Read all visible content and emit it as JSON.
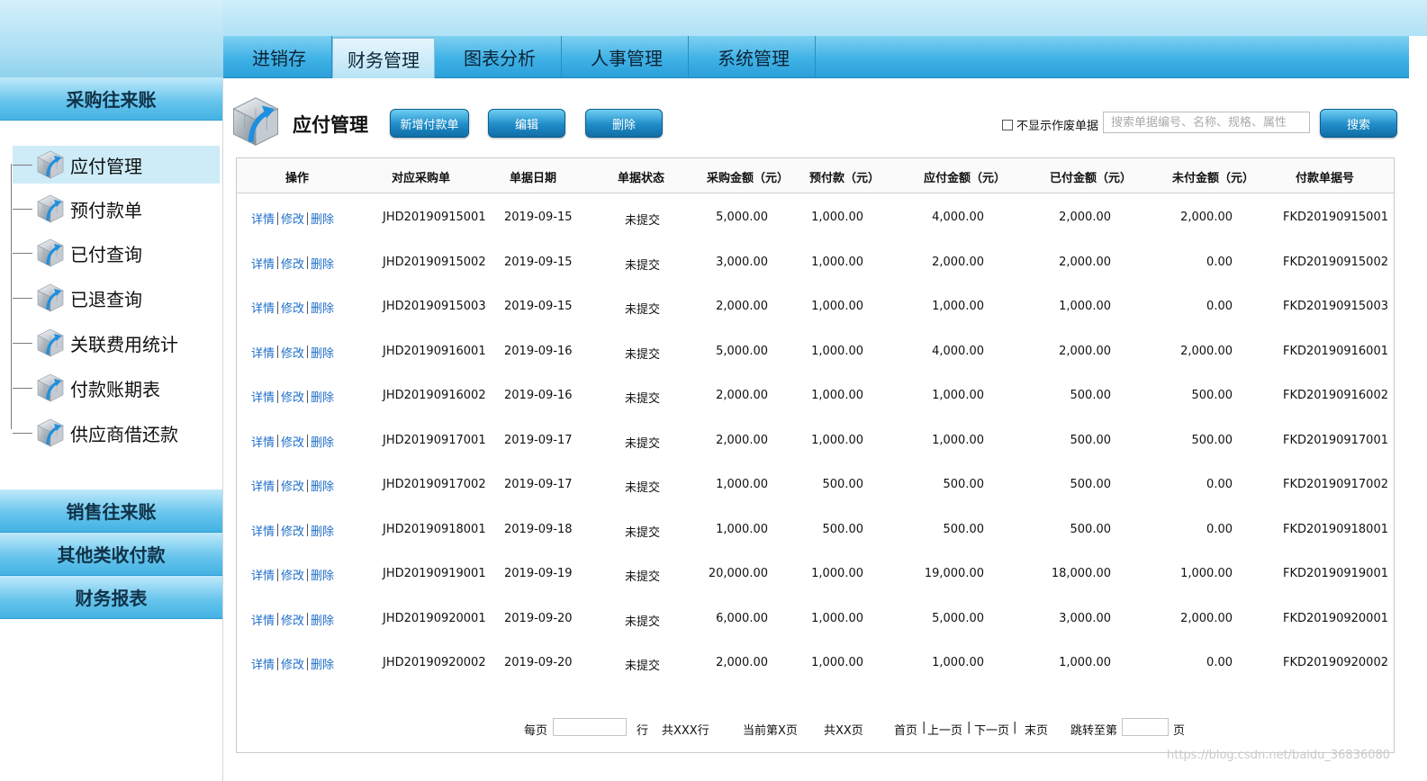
{
  "nav": {
    "tabs": [
      {
        "label": "进销存"
      },
      {
        "label": "财务管理"
      },
      {
        "label": "图表分析"
      },
      {
        "label": "人事管理"
      },
      {
        "label": "系统管理"
      }
    ],
    "active_index": 1
  },
  "sidebar": {
    "section_purchase": "采购往来账",
    "items": [
      {
        "label": "应付管理"
      },
      {
        "label": "预付款单"
      },
      {
        "label": "已付查询"
      },
      {
        "label": "已退查询"
      },
      {
        "label": "关联费用统计"
      },
      {
        "label": "付款账期表"
      },
      {
        "label": "供应商借还款"
      }
    ],
    "section_sales": "销售往来账",
    "section_other": "其他类收付款",
    "section_reports": "财务报表"
  },
  "page": {
    "title": "应付管理",
    "btn_new": "新增付款单",
    "btn_edit": "编辑",
    "btn_delete": "删除",
    "hide_void_label": "不显示作废单据",
    "search_placeholder": "搜索单据编号、名称、规格、属性",
    "search_button": "搜索"
  },
  "table": {
    "headers": [
      "操作",
      "对应采购单",
      "单据日期",
      "单据状态",
      "采购金额（元）",
      "预付款（元）",
      "应付金额（元）",
      "已付金额（元）",
      "未付金额（元）",
      "付款单据号"
    ],
    "op_detail": "详情",
    "op_edit": "修改",
    "op_delete": "删除",
    "rows": [
      {
        "order": "JHD20190915001",
        "date": "2019-09-15",
        "status": "未提交",
        "purchase": "5,000.00",
        "prepay": "1,000.00",
        "payable": "4,000.00",
        "paid": "2,000.00",
        "unpaid": "2,000.00",
        "payno": "FKD20190915001"
      },
      {
        "order": "JHD20190915002",
        "date": "2019-09-15",
        "status": "未提交",
        "purchase": "3,000.00",
        "prepay": "1,000.00",
        "payable": "2,000.00",
        "paid": "2,000.00",
        "unpaid": "0.00",
        "payno": "FKD20190915002"
      },
      {
        "order": "JHD20190915003",
        "date": "2019-09-15",
        "status": "未提交",
        "purchase": "2,000.00",
        "prepay": "1,000.00",
        "payable": "1,000.00",
        "paid": "1,000.00",
        "unpaid": "0.00",
        "payno": "FKD20190915003"
      },
      {
        "order": "JHD20190916001",
        "date": "2019-09-16",
        "status": "未提交",
        "purchase": "5,000.00",
        "prepay": "1,000.00",
        "payable": "4,000.00",
        "paid": "2,000.00",
        "unpaid": "2,000.00",
        "payno": "FKD20190916001"
      },
      {
        "order": "JHD20190916002",
        "date": "2019-09-16",
        "status": "未提交",
        "purchase": "2,000.00",
        "prepay": "1,000.00",
        "payable": "1,000.00",
        "paid": "500.00",
        "unpaid": "500.00",
        "payno": "FKD20190916002"
      },
      {
        "order": "JHD20190917001",
        "date": "2019-09-17",
        "status": "未提交",
        "purchase": "2,000.00",
        "prepay": "1,000.00",
        "payable": "1,000.00",
        "paid": "500.00",
        "unpaid": "500.00",
        "payno": "FKD20190917001"
      },
      {
        "order": "JHD20190917002",
        "date": "2019-09-17",
        "status": "未提交",
        "purchase": "1,000.00",
        "prepay": "500.00",
        "payable": "500.00",
        "paid": "500.00",
        "unpaid": "0.00",
        "payno": "FKD20190917002"
      },
      {
        "order": "JHD20190918001",
        "date": "2019-09-18",
        "status": "未提交",
        "purchase": "1,000.00",
        "prepay": "500.00",
        "payable": "500.00",
        "paid": "500.00",
        "unpaid": "0.00",
        "payno": "FKD20190918001"
      },
      {
        "order": "JHD20190919001",
        "date": "2019-09-19",
        "status": "未提交",
        "purchase": "20,000.00",
        "prepay": "1,000.00",
        "payable": "19,000.00",
        "paid": "18,000.00",
        "unpaid": "1,000.00",
        "payno": "FKD20190919001"
      },
      {
        "order": "JHD20190920001",
        "date": "2019-09-20",
        "status": "未提交",
        "purchase": "6,000.00",
        "prepay": "1,000.00",
        "payable": "5,000.00",
        "paid": "3,000.00",
        "unpaid": "2,000.00",
        "payno": "FKD20190920001"
      },
      {
        "order": "JHD20190920002",
        "date": "2019-09-20",
        "status": "未提交",
        "purchase": "2,000.00",
        "prepay": "1,000.00",
        "payable": "1,000.00",
        "paid": "1,000.00",
        "unpaid": "0.00",
        "payno": "FKD20190920002"
      }
    ]
  },
  "pager": {
    "per_page": "每页",
    "rows_unit": "行",
    "total_rows": "共XXX行",
    "current_page": "当前第X页",
    "total_pages": "共XX页",
    "first": "首页",
    "prev": "上一页",
    "next": "下一页",
    "last": "末页",
    "jump_to": "跳转至第",
    "page_unit": "页"
  },
  "watermark": "https://blog.csdn.net/baidu_36836080",
  "colors": {
    "accent": "#2b9fd8",
    "link": "#1e6ec8",
    "active_item": "#cdecf7"
  },
  "icons": {
    "tree_item": "cube-arrow-icon",
    "page_title": "cube-arrow-icon"
  }
}
